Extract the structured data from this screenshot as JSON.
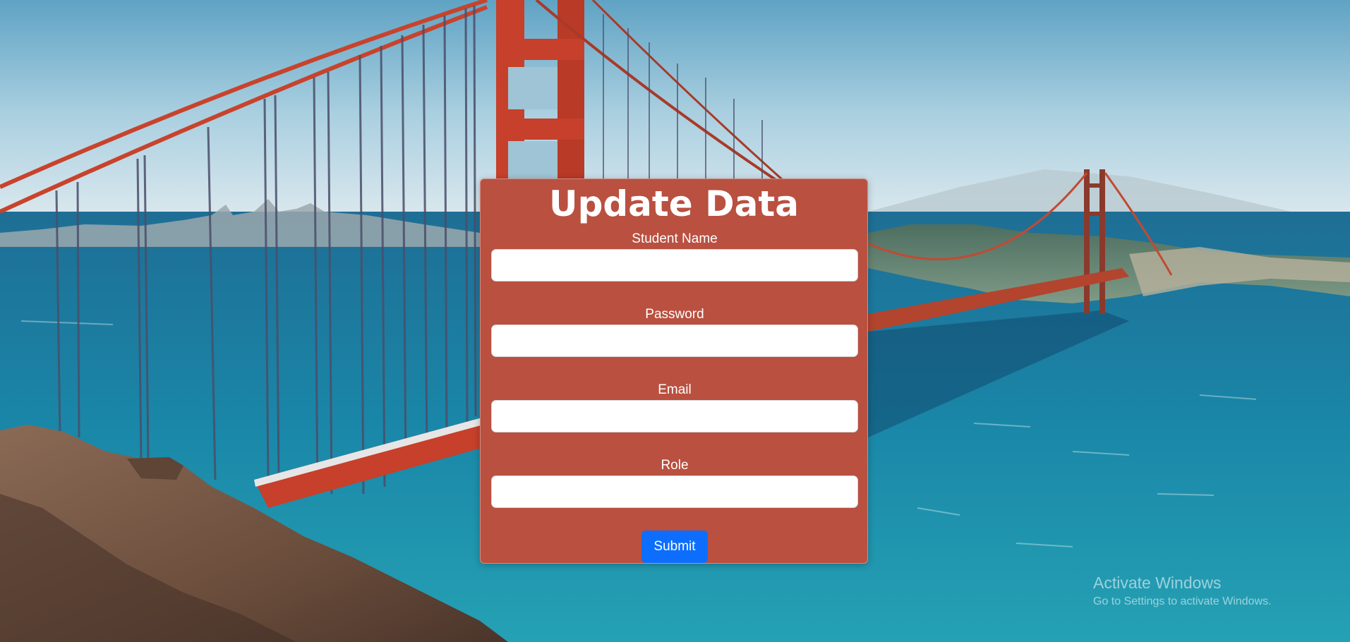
{
  "form": {
    "title": "Update Data",
    "fields": [
      {
        "label": "Student Name",
        "value": "",
        "placeholder": ""
      },
      {
        "label": "Password",
        "value": "",
        "placeholder": ""
      },
      {
        "label": "Email",
        "value": "",
        "placeholder": ""
      },
      {
        "label": "Role",
        "value": "",
        "placeholder": ""
      }
    ],
    "submit_label": "Submit"
  },
  "watermark": {
    "title": "Activate Windows",
    "subtitle": "Go to Settings to activate Windows."
  },
  "colors": {
    "card_background": "#b95040",
    "submit_button": "#0d6efd",
    "text": "#ffffff"
  }
}
